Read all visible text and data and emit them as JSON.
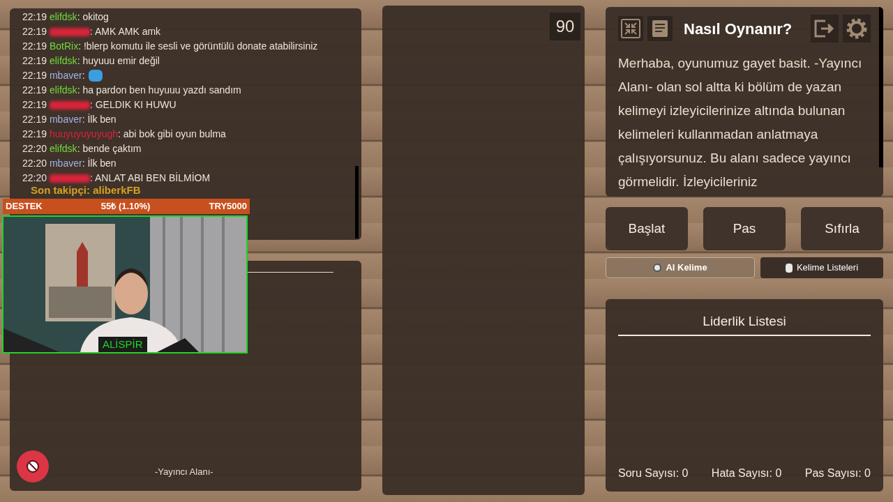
{
  "chat": {
    "messages": [
      {
        "time": "22:19",
        "user": "elifdsk",
        "color": "#6fdc3c",
        "text": ": okitog"
      },
      {
        "time": "22:19",
        "user_hidden": true,
        "color": "#d8243a",
        "text": ": AMK AMK amk"
      },
      {
        "time": "22:19",
        "user": "BotRix",
        "color": "#6fdc3c",
        "text": ": !blerp komutu ile sesli ve görüntülü donate atabilirsiniz"
      },
      {
        "time": "22:19",
        "user": "elifdsk",
        "color": "#6fdc3c",
        "text": ": huyuuu emir değil"
      },
      {
        "time": "22:19",
        "user": "mbaver",
        "color": "#9fb4e6",
        "text": ":",
        "emote": true
      },
      {
        "time": "22:19",
        "user": "elifdsk",
        "color": "#6fdc3c",
        "text": ": ha pardon ben huyuuu yazdı sandım"
      },
      {
        "time": "22:19",
        "user_hidden": true,
        "color": "#d8243a",
        "text": ": GELDIK KI HUWU"
      },
      {
        "time": "22:19",
        "user": "mbaver",
        "color": "#9fb4e6",
        "text": ": İlk ben"
      },
      {
        "time": "22:19",
        "user": "huuyuyuyuyugh",
        "color": "#d8243a",
        "text": ": abi bok gibi oyun bulma"
      },
      {
        "time": "22:20",
        "user": "elifdsk",
        "color": "#6fdc3c",
        "text": ": bende çaktım"
      },
      {
        "time": "22:20",
        "user": "mbaver",
        "color": "#9fb4e6",
        "text": ": İlk ben"
      },
      {
        "time": "22:20",
        "user_hidden": true,
        "color": "#d8243a",
        "text": ": ANLAT ABI BEN BİLMİOM"
      }
    ]
  },
  "overlay": {
    "follower": "Son takipçi: aliberkFB",
    "donation": {
      "label": "DESTEK",
      "amount": "55₺ (1.10%)",
      "goal": "TRY5000"
    },
    "webcam": {
      "kind": "picture",
      "name": "ALİSPİR"
    }
  },
  "streamer_area": {
    "label": "-Yayıncı Alanı-"
  },
  "timer": "90",
  "help": {
    "title": "Nasıl Oynanır?",
    "text": "Merhaba, oyunumuz gayet basit. -Yayıncı Alanı- olan sol altta ki bölüm de yazan kelimeyi izleyicilerinize altında bulunan kelimeleri kullanmadan anlatmaya çalışıyorsunuz. Bu alanı sadece yayıncı görmelidir. İzleyicileriniz"
  },
  "buttons": [
    "Başlat",
    "Pas",
    "Sıfırla"
  ],
  "tabs": [
    {
      "label": "Al Kelime",
      "selected": true
    },
    {
      "label": "Kelime Listeleri",
      "selected": false
    }
  ],
  "leaderboard": {
    "title": "Liderlik Listesi",
    "stats": [
      "Soru Sayısı: 0",
      "Hata Sayısı: 0",
      "Pas Sayısı: 0"
    ]
  }
}
